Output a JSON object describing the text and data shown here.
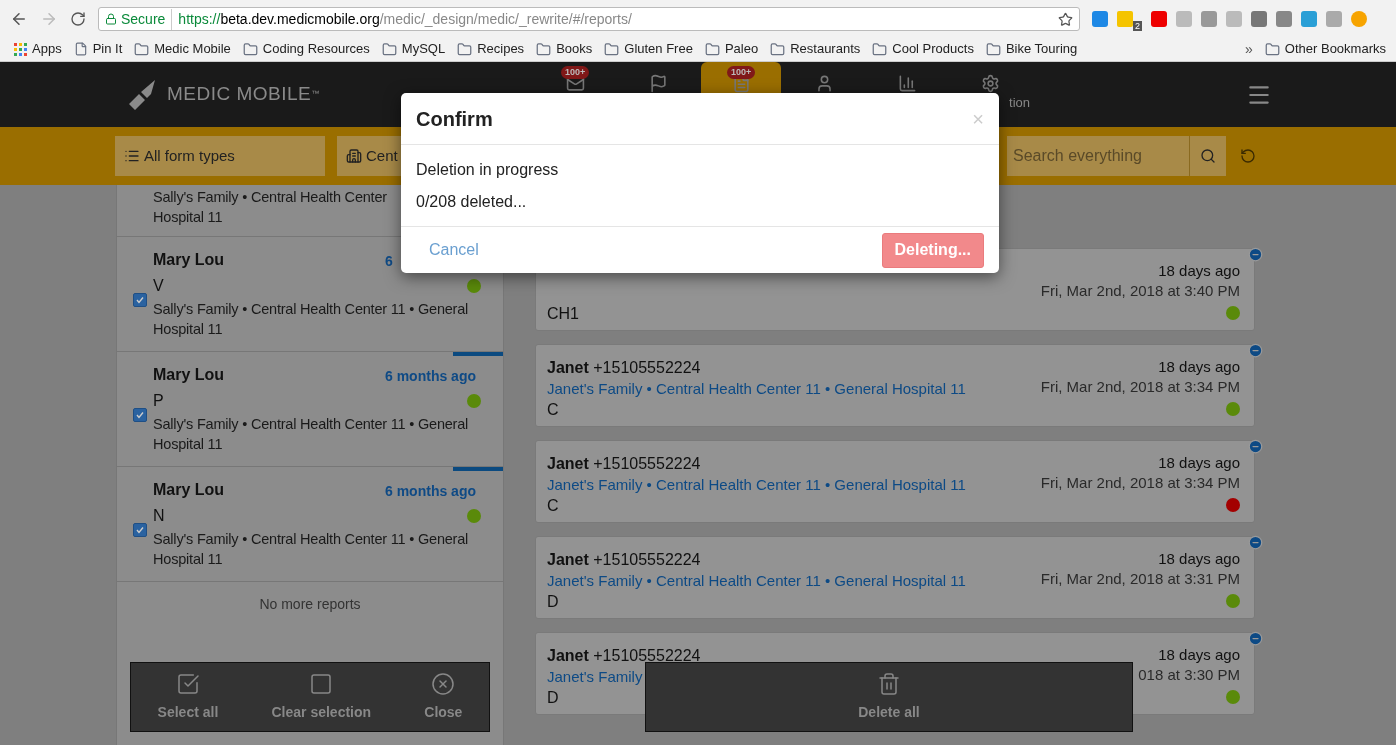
{
  "browser": {
    "secure_label": "Secure",
    "url_scheme": "https://",
    "url_host": "beta.dev.medicmobile.org",
    "url_path": "/medic/_design/medic/_rewrite/#/reports/",
    "extension_badge": "2",
    "bookmarks": [
      {
        "kind": "apps",
        "label": "Apps"
      },
      {
        "kind": "page",
        "label": "Pin It"
      },
      {
        "kind": "folder",
        "label": "Medic Mobile"
      },
      {
        "kind": "folder",
        "label": "Coding Resources"
      },
      {
        "kind": "folder",
        "label": "MySQL"
      },
      {
        "kind": "folder",
        "label": "Recipes"
      },
      {
        "kind": "folder",
        "label": "Books"
      },
      {
        "kind": "folder",
        "label": "Gluten Free"
      },
      {
        "kind": "folder",
        "label": "Paleo"
      },
      {
        "kind": "folder",
        "label": "Restaurants"
      },
      {
        "kind": "folder",
        "label": "Cool Products"
      },
      {
        "kind": "folder",
        "label": "Bike Touring"
      }
    ],
    "more": "»",
    "other_bookmarks": "Other Bookmarks"
  },
  "header": {
    "logo": "MEDIC MOBILE",
    "trademark": "™",
    "nav": [
      {
        "kind": "messages",
        "badge": "100+",
        "selected": false
      },
      {
        "kind": "tasks",
        "selected": false
      },
      {
        "kind": "reports",
        "badge": "100+",
        "selected": true
      },
      {
        "kind": "people",
        "selected": false
      },
      {
        "kind": "analytics",
        "selected": false
      },
      {
        "kind": "configuration",
        "label": "tion",
        "selected": false
      }
    ]
  },
  "filters": {
    "buttons": [
      {
        "kind": "forms",
        "label": "All form types"
      },
      {
        "kind": "places",
        "label": "Cent"
      }
    ],
    "search_placeholder": "Search everything"
  },
  "left_reports": [
    {
      "place": [
        "Sally's Family • Central Health Center",
        "Hospital 11"
      ]
    },
    {
      "name": "Mary Lou",
      "time": "6",
      "form": "V",
      "place": [
        "Sally's Family • Central Health Center 11 • General",
        "Hospital 11"
      ],
      "checked": true,
      "color": "#5a8a0a"
    },
    {
      "name": "Mary Lou",
      "time": "6 months ago",
      "form": "P",
      "place": [
        "Sally's Family • Central Health Center 11 • General",
        "Hospital 11"
      ],
      "checked": true,
      "marked": true,
      "color": "#5a8a0a"
    },
    {
      "name": "Mary Lou",
      "time": "6 months ago",
      "form": "N",
      "place": [
        "Sally's Family • Central Health Center 11 • General",
        "Hospital 11"
      ],
      "checked": true,
      "marked": true,
      "color": "#5a8a0a"
    }
  ],
  "no_more": "No more reports",
  "right_reports": [
    {
      "form": "CH1",
      "relative": "18 days ago",
      "date": "Fri, Mar 2nd, 2018 at 3:40 PM",
      "color": "#5a8a0a"
    },
    {
      "name": "Janet",
      "phone": "+15105552224",
      "place": "Janet's Family • Central Health Center 11 • General Hospital 11",
      "form": "C",
      "relative": "18 days ago",
      "date": "Fri, Mar 2nd, 2018 at 3:34 PM",
      "color": "#5a8a0a"
    },
    {
      "name": "Janet",
      "phone": "+15105552224",
      "place": "Janet's Family • Central Health Center 11 • General Hospital 11",
      "form": "C",
      "relative": "18 days ago",
      "date": "Fri, Mar 2nd, 2018 at 3:34 PM",
      "color": "#a30000"
    },
    {
      "name": "Janet",
      "phone": "+15105552224",
      "place": "Janet's Family • Central Health Center 11 • General Hospital 11",
      "form": "D",
      "relative": "18 days ago",
      "date": "Fri, Mar 2nd, 2018 at 3:31 PM",
      "color": "#5a8a0a"
    },
    {
      "name": "Janet",
      "phone": "+15105552224",
      "place": "Janet's Family",
      "form": "D",
      "relative": "18 days ago",
      "date": "018 at 3:30 PM",
      "color": "#5a8a0a"
    }
  ],
  "left_actions": [
    {
      "kind": "select",
      "label": "Select all"
    },
    {
      "kind": "clear",
      "label": "Clear selection"
    },
    {
      "kind": "close",
      "label": "Close"
    }
  ],
  "right_actions": [
    {
      "kind": "delete",
      "label": "Delete all"
    }
  ],
  "modal": {
    "title": "Confirm",
    "close": "×",
    "lines": [
      "Deletion in progress",
      "0/208 deleted..."
    ],
    "cancel": "Cancel",
    "confirm": "Deleting...",
    "confirm_disabled": true
  }
}
